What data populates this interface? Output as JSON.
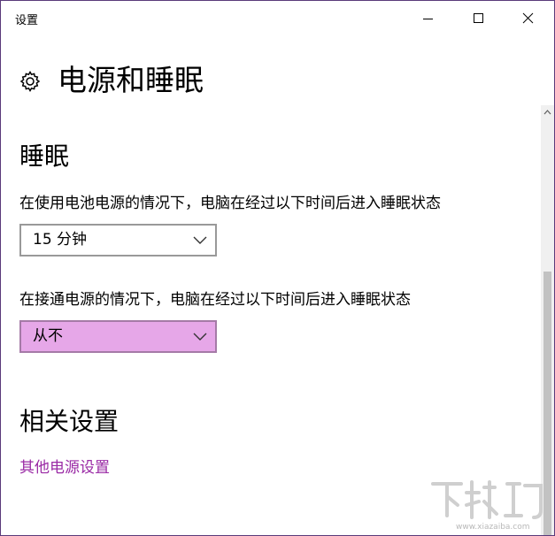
{
  "window": {
    "title": "设置"
  },
  "header": {
    "icon": "gear-icon",
    "title": "电源和睡眠"
  },
  "sleep": {
    "heading": "睡眠",
    "battery_label": "在使用电池电源的情况下，电脑在经过以下时间后进入睡眠状态",
    "battery_value": "15 分钟",
    "plugged_label": "在接通电源的情况下，电脑在经过以下时间后进入睡眠状态",
    "plugged_value": "从不"
  },
  "related": {
    "heading": "相关设置",
    "link": "其他电源设置"
  },
  "watermark": {
    "url": "www.xiazaiba.com"
  },
  "colors": {
    "accent": "#9a2aa5",
    "select_active": "#e6a7e8",
    "border": "#5a3a7a"
  }
}
